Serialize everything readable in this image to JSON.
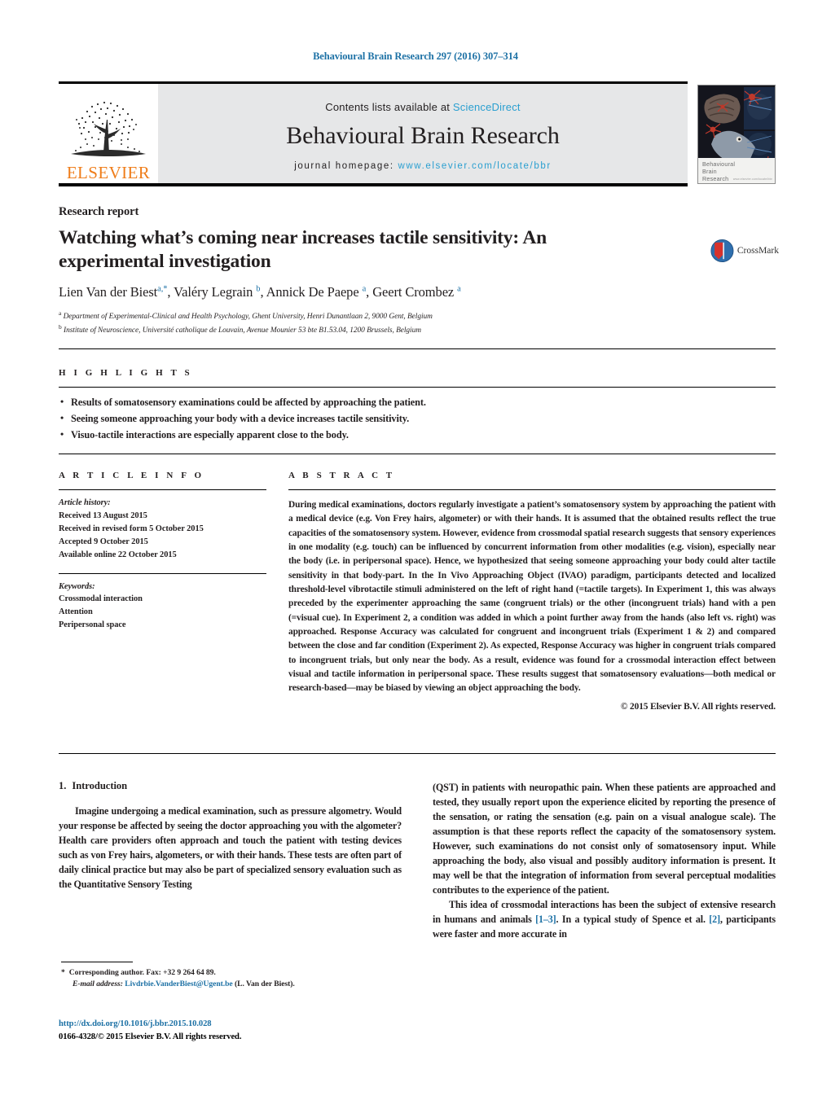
{
  "running_head": "Behavioural Brain Research 297 (2016) 307–314",
  "masthead": {
    "contents_prefix": "Contents lists available at ",
    "sciencedirect": "ScienceDirect",
    "journal_title": "Behavioural Brain Research",
    "homepage_prefix": "journal homepage:",
    "homepage_url": "www.elsevier.com/locate/bbr",
    "publisher": "ELSEVIER",
    "publisher_logo_icon": "elsevier-tree-icon",
    "cover_title_line1": "Behavioural",
    "cover_title_line2": "Brain",
    "cover_title_line3": "Research",
    "cover_tiny_text": "www.elsevier.com/locate/bbr",
    "colors": {
      "link": "#2a9fd0",
      "elsevier_orange": "#ef7d1a",
      "masthead_bg": "#e6e7e8"
    }
  },
  "article": {
    "kicker": "Research report",
    "title": "Watching what’s coming near increases tactile sensitivity: An experimental investigation",
    "authors_html": "Lien Van der Biest<sup>a,*</sup>, Valéry Legrain <sup>b</sup>, Annick De Paepe <sup>a</sup>, Geert Crombez <sup>a</sup>",
    "affiliations": [
      "Department of Experimental-Clinical and Health Psychology, Ghent University, Henri Dunantlaan 2, 9000 Gent, Belgium",
      "Institute of Neuroscience, Université catholique de Louvain, Avenue Mounier 53 bte B1.53.04, 1200 Brussels, Belgium"
    ],
    "affiliation_markers": [
      "a",
      "b"
    ],
    "crossmark_label": "CrossMark",
    "crossmark_icon": "crossmark-badge-icon"
  },
  "highlights": {
    "label": "H I G H L I G H T S",
    "items": [
      "Results of somatosensory examinations could be affected by approaching the patient.",
      "Seeing someone approaching your body with a device increases tactile sensitivity.",
      "Visuo-tactile interactions are especially apparent close to the body."
    ]
  },
  "article_info": {
    "label": "A R T I C L E   I N F O",
    "history_label": "Article history:",
    "history": [
      "Received 13 August 2015",
      "Received in revised form 5 October 2015",
      "Accepted 9 October 2015",
      "Available online 22 October 2015"
    ],
    "keywords_label": "Keywords:",
    "keywords": [
      "Crossmodal interaction",
      "Attention",
      "Peripersonal space"
    ]
  },
  "abstract": {
    "label": "A B S T R A C T",
    "text": "During medical examinations, doctors regularly investigate a patient’s somatosensory system by approaching the patient with a medical device (e.g. Von Frey hairs, algometer) or with their hands. It is assumed that the obtained results reflect the true capacities of the somatosensory system. However, evidence from crossmodal spatial research suggests that sensory experiences in one modality (e.g. touch) can be influenced by concurrent information from other modalities (e.g. vision), especially near the body (i.e. in peripersonal space). Hence, we hypothesized that seeing someone approaching your body could alter tactile sensitivity in that body-part. In the In Vivo Approaching Object (IVAO) paradigm, participants detected and localized threshold-level vibrotactile stimuli administered on the left of right hand (=tactile targets). In Experiment 1, this was always preceded by the experimenter approaching the same (congruent trials) or the other (incongruent trials) hand with a pen (=visual cue). In Experiment 2, a condition was added in which a point further away from the hands (also left vs. right) was approached. Response Accuracy was calculated for congruent and incongruent trials (Experiment 1 & 2) and compared between the close and far condition (Experiment 2). As expected, Response Accuracy was higher in congruent trials compared to incongruent trials, but only near the body. As a result, evidence was found for a crossmodal interaction effect between visual and tactile information in peripersonal space. These results suggest that somatosensory evaluations—both medical or research-based—may be biased by viewing an object approaching the body.",
    "copyright": "© 2015 Elsevier B.V. All rights reserved."
  },
  "introduction": {
    "number": "1.",
    "heading": "Introduction",
    "left_paragraph": "Imagine undergoing a medical examination, such as pressure algometry. Would your response be affected by seeing the doctor approaching you with the algometer? Health care providers often approach and touch the patient with testing devices such as von Frey hairs, algometers, or with their hands. These tests are often part of daily clinical practice but may also be part of specialized sensory evaluation such as the Quantitative Sensory Testing",
    "right_paragraph_1": "(QST) in patients with neuropathic pain. When these patients are approached and tested, they usually report upon the experience elicited by reporting the presence of the sensation, or rating the sensation (e.g. pain on a visual analogue scale). The assumption is that these reports reflect the capacity of the somatosensory system. However, such examinations do not consist only of somatosensory input. While approaching the body, also visual and possibly auditory information is present. It may well be that the integration of information from several perceptual modalities contributes to the experience of the patient.",
    "right_paragraph_2_a": "This idea of crossmodal interactions has been the subject of extensive research in humans and animals ",
    "right_ref_1": "[1–3]",
    "right_paragraph_2_b": ". In a typical study of Spence et al. ",
    "right_ref_2": "[2]",
    "right_paragraph_2_c": ", participants were faster and more accurate in"
  },
  "footer": {
    "corresponding_marker": "*",
    "corresponding_text": "Corresponding author. Fax: +32 9 264 64 89.",
    "email_label": "E-mail address:",
    "email": "Livdrbie.VanderBiest@Ugent.be",
    "email_suffix": "(L. Van der Biest).",
    "doi": "http://dx.doi.org/10.1016/j.bbr.2015.10.028",
    "issn_line": "0166-4328/© 2015 Elsevier B.V. All rights reserved."
  }
}
